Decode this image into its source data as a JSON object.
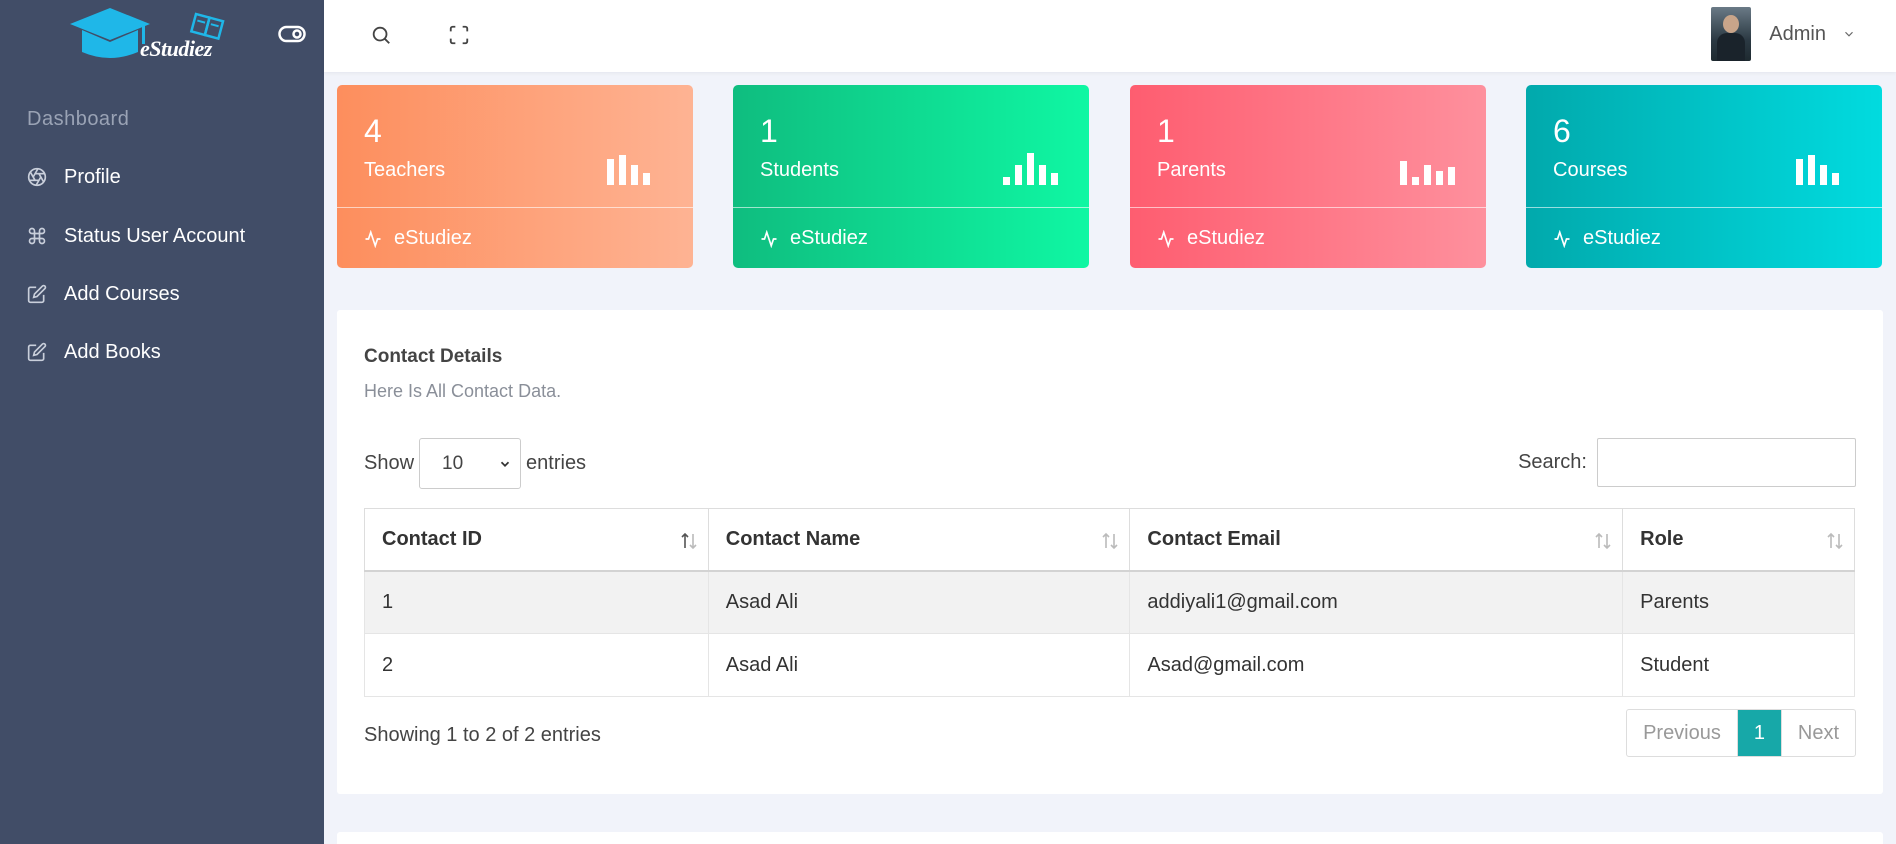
{
  "brand": {
    "name": "eStudiez",
    "logo_icon": "graduation-cap-book-icon"
  },
  "sidebar": {
    "section_title": "Dashboard",
    "items": [
      {
        "label": "Profile",
        "icon": "aperture-icon"
      },
      {
        "label": "Status User Account",
        "icon": "command-icon"
      },
      {
        "label": "Add Courses",
        "icon": "edit-icon"
      },
      {
        "label": "Add Books",
        "icon": "edit-icon"
      }
    ]
  },
  "topbar": {
    "user_name": "Admin"
  },
  "stats": [
    {
      "value": "4",
      "label": "Teachers",
      "footer": "eStudiez",
      "color_from": "#fd8e5d",
      "color_to": "#feb393"
    },
    {
      "value": "1",
      "label": "Students",
      "footer": "eStudiez",
      "color_from": "#0fbd7f",
      "color_to": "#0ff7a3"
    },
    {
      "value": "1",
      "label": "Parents",
      "footer": "eStudiez",
      "color_from": "#fe5d70",
      "color_to": "#fe909d"
    },
    {
      "value": "6",
      "label": "Courses",
      "footer": "eStudiez",
      "color_from": "#01a9ac",
      "color_to": "#01dbdf"
    }
  ],
  "contacts": {
    "title": "Contact Details",
    "subtitle": "Here Is All Contact Data.",
    "show_label": "Show",
    "entries_label": "entries",
    "page_size": "10",
    "search_label": "Search:",
    "search_value": "",
    "columns": [
      "Contact ID",
      "Contact Name",
      "Contact Email",
      "Role"
    ],
    "rows": [
      [
        "1",
        "Asad Ali",
        "addiyali1@gmail.com",
        "Parents"
      ],
      [
        "2",
        "Asad Ali",
        "Asad@gmail.com",
        "Student"
      ]
    ],
    "info": "Showing 1 to 2 of 2 entries",
    "pagination": {
      "previous": "Previous",
      "current": "1",
      "next": "Next"
    }
  }
}
